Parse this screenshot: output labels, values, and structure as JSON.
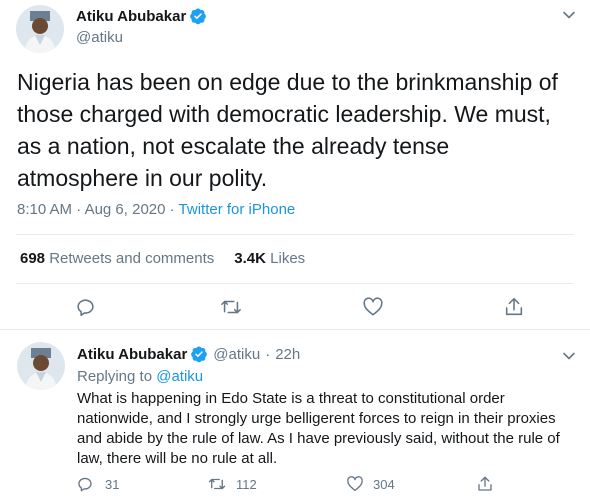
{
  "main_tweet": {
    "author_name": "Atiku Abubakar",
    "author_handle": "@atiku",
    "text": "Nigeria has been on edge due to the brinkmanship of those charged with democratic leadership. We must, as a nation, not escalate the already tense atmosphere in our polity.",
    "time": "8:10 AM",
    "date": "Aug 6, 2020",
    "separator": "·",
    "source": "Twitter for iPhone",
    "retweets_count": "698",
    "retweets_label": "Retweets and comments",
    "likes_count": "3.4K",
    "likes_label": "Likes",
    "icons": [
      "reply-icon",
      "retweet-icon",
      "like-icon",
      "share-icon"
    ]
  },
  "reply_tweet": {
    "author_name": "Atiku Abubakar",
    "author_handle": "@atiku",
    "separator": "·",
    "age": "22h",
    "replying_label": "Replying to",
    "replying_to": "@atiku",
    "text": "What is happening in Edo State is a threat to constitutional order nationwide, and I strongly urge belligerent forces to reign in their proxies and abide by the rule of law. As I have previously said, without the rule of law, there will be no rule at all.",
    "reply_count": "31",
    "retweet_count": "112",
    "like_count": "304"
  },
  "colors": {
    "accent": "#1b95e0",
    "verified": "#1da1f2",
    "muted": "#657786",
    "text": "#14171a",
    "border": "#e6ecf0"
  }
}
